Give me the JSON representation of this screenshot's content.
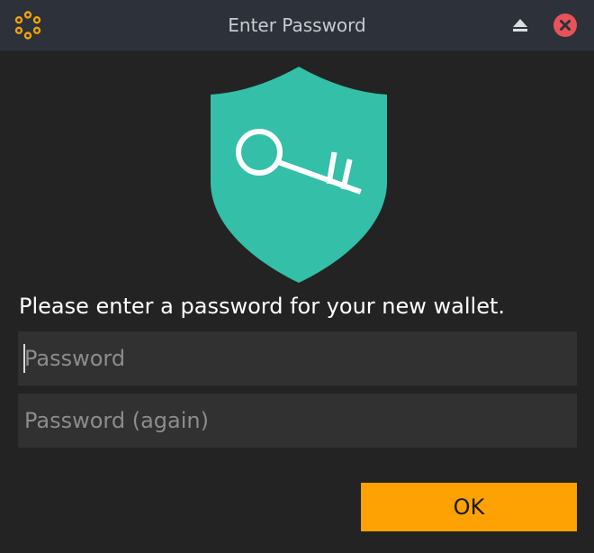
{
  "window": {
    "title": "Enter Password",
    "app_icon": "ring-of-dots-logo",
    "controls": {
      "shade_icon": "eject-icon",
      "close_icon": "close-icon"
    }
  },
  "main": {
    "graphic_icon": "shield-key-icon",
    "prompt": "Please enter a password for your new wallet.",
    "password": {
      "value": "",
      "placeholder": "Password"
    },
    "password_again": {
      "value": "",
      "placeholder": "Password (again)"
    },
    "ok_label": "OK"
  },
  "colors": {
    "titlebar": "#2d3139",
    "background": "#232323",
    "field": "#313131",
    "accent": "#fea103",
    "shield": "#33bfa8",
    "close": "#e8535a"
  }
}
